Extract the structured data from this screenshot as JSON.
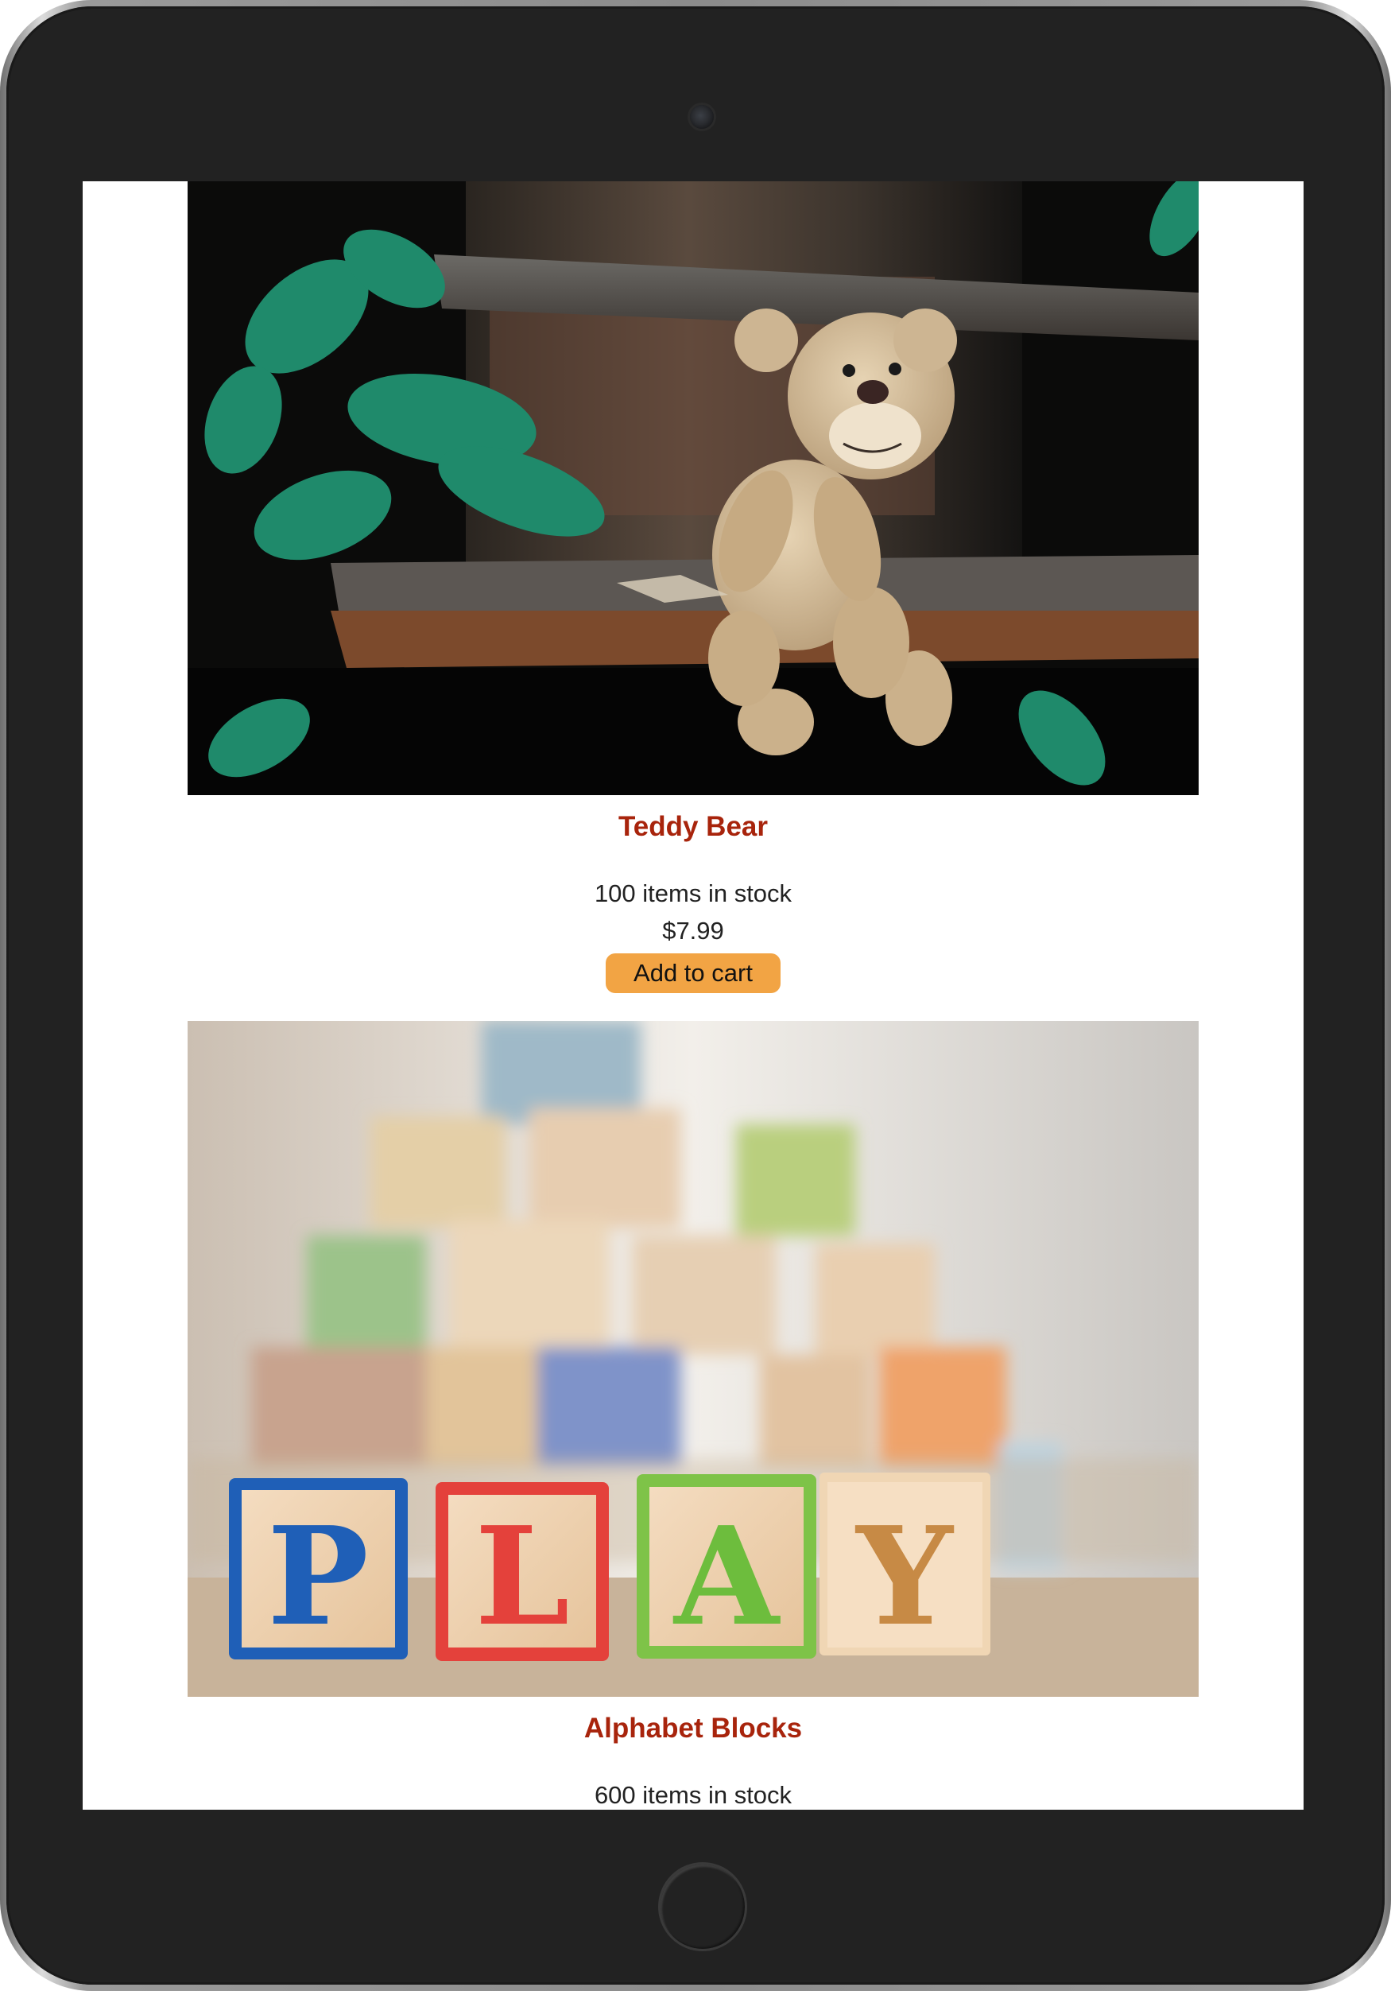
{
  "products": [
    {
      "name": "Teddy Bear",
      "stock": "100 items in stock",
      "price": "$7.99",
      "button_label": "Add to cart",
      "image": "teddy-bear-photo"
    },
    {
      "name": "Alphabet Blocks",
      "stock": "600 items in stock",
      "image": "alphabet-blocks-photo",
      "block_letters": [
        "P",
        "L",
        "A",
        "Y"
      ]
    }
  ],
  "colors": {
    "product_name": "#a8240c",
    "button": "#f2a444",
    "device_bezel": "#222222"
  }
}
